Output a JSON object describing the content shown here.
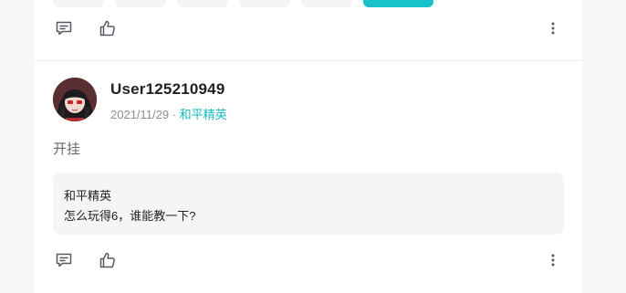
{
  "colors": {
    "accent": "#17c3c8",
    "link": "#16b8c0",
    "meta": "#8a8f99",
    "quote_bg": "#f4f5f7"
  },
  "top_actions": {
    "comment_icon": "comment-icon",
    "like_icon": "thumbs-up-icon",
    "more_icon": "more-vertical-icon"
  },
  "post": {
    "username": "User125210949",
    "date": "2021/11/29",
    "separator": " · ",
    "game_tag": "和平精英",
    "text": "开挂",
    "quote": {
      "title": "和平精英",
      "body": "怎么玩得6，谁能教一下?"
    },
    "actions": {
      "comment_icon": "comment-icon",
      "like_icon": "thumbs-up-icon",
      "more_icon": "more-vertical-icon"
    }
  }
}
